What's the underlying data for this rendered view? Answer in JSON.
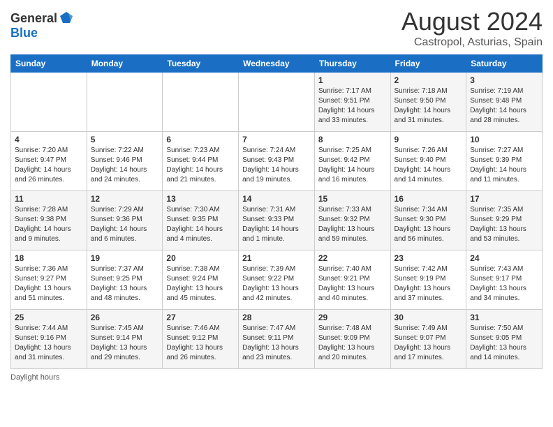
{
  "header": {
    "logo_general": "General",
    "logo_blue": "Blue",
    "month_title": "August 2024",
    "location": "Castropol, Asturias, Spain"
  },
  "weekdays": [
    "Sunday",
    "Monday",
    "Tuesday",
    "Wednesday",
    "Thursday",
    "Friday",
    "Saturday"
  ],
  "footer": {
    "note": "Daylight hours"
  },
  "weeks": [
    [
      {
        "day": "",
        "sunrise": "",
        "sunset": "",
        "daylight": ""
      },
      {
        "day": "",
        "sunrise": "",
        "sunset": "",
        "daylight": ""
      },
      {
        "day": "",
        "sunrise": "",
        "sunset": "",
        "daylight": ""
      },
      {
        "day": "",
        "sunrise": "",
        "sunset": "",
        "daylight": ""
      },
      {
        "day": "1",
        "sunrise": "Sunrise: 7:17 AM",
        "sunset": "Sunset: 9:51 PM",
        "daylight": "Daylight: 14 hours and 33 minutes."
      },
      {
        "day": "2",
        "sunrise": "Sunrise: 7:18 AM",
        "sunset": "Sunset: 9:50 PM",
        "daylight": "Daylight: 14 hours and 31 minutes."
      },
      {
        "day": "3",
        "sunrise": "Sunrise: 7:19 AM",
        "sunset": "Sunset: 9:48 PM",
        "daylight": "Daylight: 14 hours and 28 minutes."
      }
    ],
    [
      {
        "day": "4",
        "sunrise": "Sunrise: 7:20 AM",
        "sunset": "Sunset: 9:47 PM",
        "daylight": "Daylight: 14 hours and 26 minutes."
      },
      {
        "day": "5",
        "sunrise": "Sunrise: 7:22 AM",
        "sunset": "Sunset: 9:46 PM",
        "daylight": "Daylight: 14 hours and 24 minutes."
      },
      {
        "day": "6",
        "sunrise": "Sunrise: 7:23 AM",
        "sunset": "Sunset: 9:44 PM",
        "daylight": "Daylight: 14 hours and 21 minutes."
      },
      {
        "day": "7",
        "sunrise": "Sunrise: 7:24 AM",
        "sunset": "Sunset: 9:43 PM",
        "daylight": "Daylight: 14 hours and 19 minutes."
      },
      {
        "day": "8",
        "sunrise": "Sunrise: 7:25 AM",
        "sunset": "Sunset: 9:42 PM",
        "daylight": "Daylight: 14 hours and 16 minutes."
      },
      {
        "day": "9",
        "sunrise": "Sunrise: 7:26 AM",
        "sunset": "Sunset: 9:40 PM",
        "daylight": "Daylight: 14 hours and 14 minutes."
      },
      {
        "day": "10",
        "sunrise": "Sunrise: 7:27 AM",
        "sunset": "Sunset: 9:39 PM",
        "daylight": "Daylight: 14 hours and 11 minutes."
      }
    ],
    [
      {
        "day": "11",
        "sunrise": "Sunrise: 7:28 AM",
        "sunset": "Sunset: 9:38 PM",
        "daylight": "Daylight: 14 hours and 9 minutes."
      },
      {
        "day": "12",
        "sunrise": "Sunrise: 7:29 AM",
        "sunset": "Sunset: 9:36 PM",
        "daylight": "Daylight: 14 hours and 6 minutes."
      },
      {
        "day": "13",
        "sunrise": "Sunrise: 7:30 AM",
        "sunset": "Sunset: 9:35 PM",
        "daylight": "Daylight: 14 hours and 4 minutes."
      },
      {
        "day": "14",
        "sunrise": "Sunrise: 7:31 AM",
        "sunset": "Sunset: 9:33 PM",
        "daylight": "Daylight: 14 hours and 1 minute."
      },
      {
        "day": "15",
        "sunrise": "Sunrise: 7:33 AM",
        "sunset": "Sunset: 9:32 PM",
        "daylight": "Daylight: 13 hours and 59 minutes."
      },
      {
        "day": "16",
        "sunrise": "Sunrise: 7:34 AM",
        "sunset": "Sunset: 9:30 PM",
        "daylight": "Daylight: 13 hours and 56 minutes."
      },
      {
        "day": "17",
        "sunrise": "Sunrise: 7:35 AM",
        "sunset": "Sunset: 9:29 PM",
        "daylight": "Daylight: 13 hours and 53 minutes."
      }
    ],
    [
      {
        "day": "18",
        "sunrise": "Sunrise: 7:36 AM",
        "sunset": "Sunset: 9:27 PM",
        "daylight": "Daylight: 13 hours and 51 minutes."
      },
      {
        "day": "19",
        "sunrise": "Sunrise: 7:37 AM",
        "sunset": "Sunset: 9:25 PM",
        "daylight": "Daylight: 13 hours and 48 minutes."
      },
      {
        "day": "20",
        "sunrise": "Sunrise: 7:38 AM",
        "sunset": "Sunset: 9:24 PM",
        "daylight": "Daylight: 13 hours and 45 minutes."
      },
      {
        "day": "21",
        "sunrise": "Sunrise: 7:39 AM",
        "sunset": "Sunset: 9:22 PM",
        "daylight": "Daylight: 13 hours and 42 minutes."
      },
      {
        "day": "22",
        "sunrise": "Sunrise: 7:40 AM",
        "sunset": "Sunset: 9:21 PM",
        "daylight": "Daylight: 13 hours and 40 minutes."
      },
      {
        "day": "23",
        "sunrise": "Sunrise: 7:42 AM",
        "sunset": "Sunset: 9:19 PM",
        "daylight": "Daylight: 13 hours and 37 minutes."
      },
      {
        "day": "24",
        "sunrise": "Sunrise: 7:43 AM",
        "sunset": "Sunset: 9:17 PM",
        "daylight": "Daylight: 13 hours and 34 minutes."
      }
    ],
    [
      {
        "day": "25",
        "sunrise": "Sunrise: 7:44 AM",
        "sunset": "Sunset: 9:16 PM",
        "daylight": "Daylight: 13 hours and 31 minutes."
      },
      {
        "day": "26",
        "sunrise": "Sunrise: 7:45 AM",
        "sunset": "Sunset: 9:14 PM",
        "daylight": "Daylight: 13 hours and 29 minutes."
      },
      {
        "day": "27",
        "sunrise": "Sunrise: 7:46 AM",
        "sunset": "Sunset: 9:12 PM",
        "daylight": "Daylight: 13 hours and 26 minutes."
      },
      {
        "day": "28",
        "sunrise": "Sunrise: 7:47 AM",
        "sunset": "Sunset: 9:11 PM",
        "daylight": "Daylight: 13 hours and 23 minutes."
      },
      {
        "day": "29",
        "sunrise": "Sunrise: 7:48 AM",
        "sunset": "Sunset: 9:09 PM",
        "daylight": "Daylight: 13 hours and 20 minutes."
      },
      {
        "day": "30",
        "sunrise": "Sunrise: 7:49 AM",
        "sunset": "Sunset: 9:07 PM",
        "daylight": "Daylight: 13 hours and 17 minutes."
      },
      {
        "day": "31",
        "sunrise": "Sunrise: 7:50 AM",
        "sunset": "Sunset: 9:05 PM",
        "daylight": "Daylight: 13 hours and 14 minutes."
      }
    ]
  ]
}
